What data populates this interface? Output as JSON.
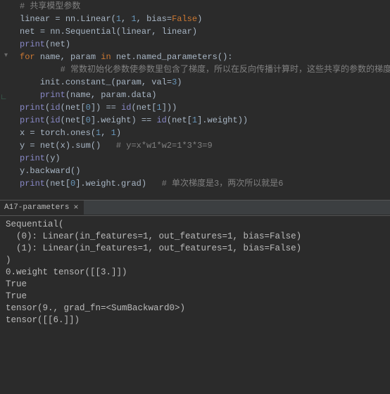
{
  "editor": {
    "lines": [
      {
        "indent": 0,
        "segments": [
          {
            "cls": "cmt",
            "t": "# 共享模型参数"
          }
        ]
      },
      {
        "indent": 0,
        "segments": [
          {
            "cls": "",
            "t": "linear "
          },
          {
            "cls": "op",
            "t": "= "
          },
          {
            "cls": "",
            "t": "nn.Linear("
          },
          {
            "cls": "num",
            "t": "1"
          },
          {
            "cls": "",
            "t": ", "
          },
          {
            "cls": "num",
            "t": "1"
          },
          {
            "cls": "",
            "t": ", "
          },
          {
            "cls": "param",
            "t": "bias"
          },
          {
            "cls": "op",
            "t": "="
          },
          {
            "cls": "kw",
            "t": "False"
          },
          {
            "cls": "",
            "t": ")"
          }
        ]
      },
      {
        "indent": 0,
        "segments": [
          {
            "cls": "",
            "t": "net "
          },
          {
            "cls": "op",
            "t": "= "
          },
          {
            "cls": "",
            "t": "nn.Sequential(linear"
          },
          {
            "cls": "op",
            "t": ", "
          },
          {
            "cls": "",
            "t": "linear)"
          }
        ]
      },
      {
        "indent": 0,
        "segments": [
          {
            "cls": "builtin",
            "t": "print"
          },
          {
            "cls": "",
            "t": "(net)"
          }
        ]
      },
      {
        "indent": 0,
        "fold": true,
        "segments": [
          {
            "cls": "kw",
            "t": "for "
          },
          {
            "cls": "",
            "t": "name"
          },
          {
            "cls": "op",
            "t": ", "
          },
          {
            "cls": "",
            "t": "param "
          },
          {
            "cls": "kw",
            "t": "in "
          },
          {
            "cls": "",
            "t": "net.named_parameters():"
          }
        ]
      },
      {
        "indent": 2,
        "segments": [
          {
            "cls": "cmt",
            "t": "# 常数初始化参数使参数里包含了梯度，所以在反向传播计算时，这些共享的参数的梯度是累加的"
          }
        ]
      },
      {
        "indent": 1,
        "segments": [
          {
            "cls": "",
            "t": "init.constant_(param"
          },
          {
            "cls": "op",
            "t": ", "
          },
          {
            "cls": "param",
            "t": "val"
          },
          {
            "cls": "op",
            "t": "="
          },
          {
            "cls": "num",
            "t": "3"
          },
          {
            "cls": "",
            "t": ")"
          }
        ]
      },
      {
        "indent": 1,
        "tick": true,
        "segments": [
          {
            "cls": "builtin",
            "t": "print"
          },
          {
            "cls": "",
            "t": "(name"
          },
          {
            "cls": "op",
            "t": ", "
          },
          {
            "cls": "",
            "t": "param.data)"
          }
        ]
      },
      {
        "indent": 0,
        "segments": [
          {
            "cls": "builtin",
            "t": "print"
          },
          {
            "cls": "",
            "t": "("
          },
          {
            "cls": "builtin",
            "t": "id"
          },
          {
            "cls": "",
            "t": "(net["
          },
          {
            "cls": "num",
            "t": "0"
          },
          {
            "cls": "",
            "t": "]) "
          },
          {
            "cls": "op",
            "t": "== "
          },
          {
            "cls": "builtin",
            "t": "id"
          },
          {
            "cls": "",
            "t": "(net["
          },
          {
            "cls": "num",
            "t": "1"
          },
          {
            "cls": "",
            "t": "]))"
          }
        ]
      },
      {
        "indent": 0,
        "segments": [
          {
            "cls": "builtin",
            "t": "print"
          },
          {
            "cls": "",
            "t": "("
          },
          {
            "cls": "builtin",
            "t": "id"
          },
          {
            "cls": "",
            "t": "(net["
          },
          {
            "cls": "num",
            "t": "0"
          },
          {
            "cls": "",
            "t": "].weight) "
          },
          {
            "cls": "op",
            "t": "== "
          },
          {
            "cls": "builtin",
            "t": "id"
          },
          {
            "cls": "",
            "t": "(net["
          },
          {
            "cls": "num",
            "t": "1"
          },
          {
            "cls": "",
            "t": "].weight))"
          }
        ]
      },
      {
        "indent": 0,
        "segments": [
          {
            "cls": "",
            "t": ""
          }
        ]
      },
      {
        "indent": 0,
        "segments": [
          {
            "cls": "",
            "t": "x "
          },
          {
            "cls": "op",
            "t": "= "
          },
          {
            "cls": "",
            "t": "torch.ones("
          },
          {
            "cls": "num",
            "t": "1"
          },
          {
            "cls": "op",
            "t": ", "
          },
          {
            "cls": "num",
            "t": "1"
          },
          {
            "cls": "",
            "t": ")"
          }
        ]
      },
      {
        "indent": 0,
        "segments": [
          {
            "cls": "",
            "t": "y "
          },
          {
            "cls": "op",
            "t": "= "
          },
          {
            "cls": "",
            "t": "net(x).sum()   "
          },
          {
            "cls": "cmt",
            "t": "# y=x*w1*w2=1*3*3=9"
          }
        ]
      },
      {
        "indent": 0,
        "segments": [
          {
            "cls": "builtin",
            "t": "print"
          },
          {
            "cls": "",
            "t": "(y)"
          }
        ]
      },
      {
        "indent": 0,
        "segments": [
          {
            "cls": "",
            "t": "y.backward()"
          }
        ]
      },
      {
        "indent": 0,
        "segments": [
          {
            "cls": "builtin",
            "t": "print"
          },
          {
            "cls": "",
            "t": "(net["
          },
          {
            "cls": "num",
            "t": "0"
          },
          {
            "cls": "",
            "t": "].weight.grad)   "
          },
          {
            "cls": "cmt",
            "t": "# 单次梯度是3，两次所以就是6"
          }
        ]
      }
    ]
  },
  "terminal": {
    "tab_label": "A17-parameters",
    "output": [
      "Sequential(",
      "  (0): Linear(in_features=1, out_features=1, bias=False)",
      "  (1): Linear(in_features=1, out_features=1, bias=False)",
      ")",
      "0.weight tensor([[3.]])",
      "True",
      "True",
      "tensor(9., grad_fn=<SumBackward0>)",
      "tensor([[6.]])"
    ]
  }
}
